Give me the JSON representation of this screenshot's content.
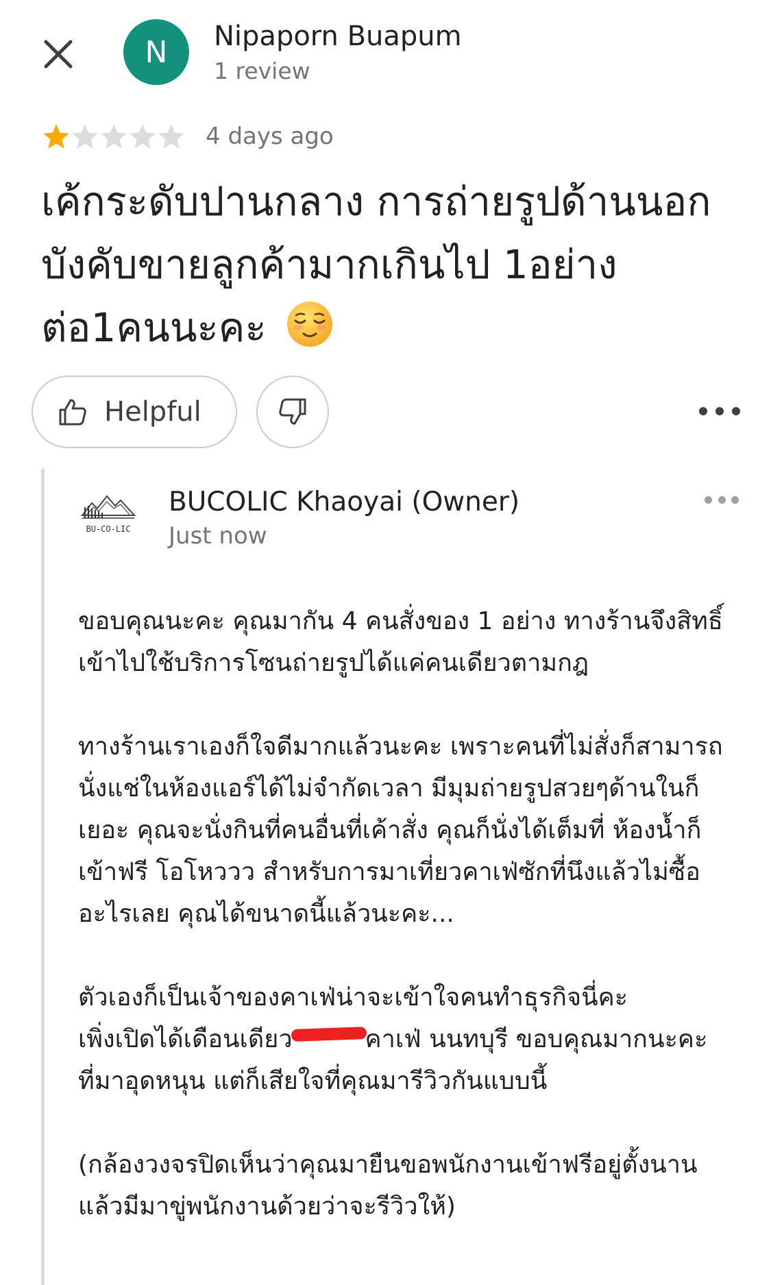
{
  "review": {
    "reviewer": {
      "initial": "N",
      "avatar_color": "#13917d",
      "name": "Nipaporn Buapum",
      "review_count": "1 review"
    },
    "rating": 1,
    "rating_max": 5,
    "star_filled_color": "#f9ab00",
    "star_empty_color": "#dadce0",
    "date": "4 days ago",
    "text": "เค้กระดับปานกลาง การถ่ายรูปด้านนอก บังคับขายลูกค้ามากเกินไป 1อย่างต่อ1คนนะคะ",
    "emoji": "relieved-face-emoji"
  },
  "actions": {
    "helpful_label": "Helpful",
    "helpful_icon": "thumbs-up-icon",
    "dislike_icon": "thumbs-down-icon",
    "more_icon": "more-horizontal-icon",
    "close_icon": "close-icon"
  },
  "owner_reply": {
    "name": "BUCOLIC Khaoyai (Owner)",
    "time": "Just now",
    "logo": "bucolic-logo",
    "logo_text": "BU-CO-LIC",
    "paragraphs": [
      "ขอบคุณนะคะ คุณมากัน 4 คนสั่งของ 1 อย่าง ทางร้านจึงสิทธิ์เข้าไปใช้บริการโซนถ่ายรูปได้แค่คนเดียวตามกฎ",
      "ทางร้านเราเองก็ใจดีมากแล้วนะคะ เพราะคนที่ไม่สั่งก็สามารถนั่งแช่ในห้องแอร์ได้ไม่จำกัดเวลา มีมุมถ่ายรูปสวยๆด้านในก็เยอะ คุณจะนั่งกินที่คนอื่นที่เค้าสั่ง คุณก็นั่งได้เต็มที่ ห้องน้ำก็เข้าฟรี โอโหววว สำหรับการมาเที่ยวคาเฟ่ซักที่นึงแล้วไม่ซื้ออะไรเลย คุณได้ขนาดนี้แล้วนะคะ...",
      "ตัวเองก็เป็นเจ้าของคาเฟ่น่าจะเข้าใจคนทำธุรกิจนี่คะ",
      "(กล้องวงจรปิดเห็นว่าคุณมายืนขอพนักงานเข้าฟรีอยู่ตั้งนาน แล้วมีมาขู่พนักงานด้วยว่าจะรีวิวให้)"
    ],
    "paragraph_3_parts": {
      "before_redaction": "เพิ่งเปิดได้เดือนเดียว",
      "after_redaction": "คาเฟ่ นนทบุรี ขอบคุณมากนะคะที่มาอุดหนุน แต่ก็เสียใจที่คุณมารีวิวกันแบบนี้"
    },
    "redaction_color": "#ee2121"
  }
}
